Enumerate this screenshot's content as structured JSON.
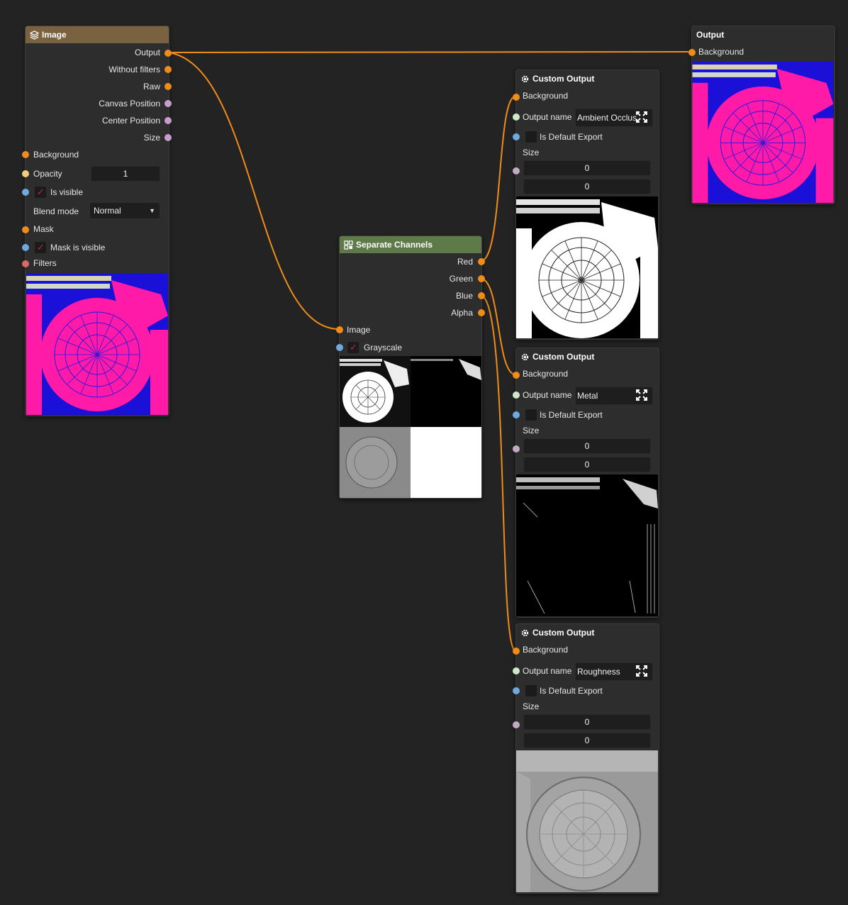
{
  "image_node": {
    "title": "Image",
    "outputs": [
      "Output",
      "Without filters",
      "Raw",
      "Canvas Position",
      "Center Position",
      "Size"
    ],
    "background_label": "Background",
    "opacity_label": "Opacity",
    "opacity_value": "1",
    "is_visible_label": "Is visible",
    "blend_mode_label": "Blend mode",
    "blend_mode_value": "Normal",
    "mask_label": "Mask",
    "mask_visible_label": "Mask is visible",
    "filters_label": "Filters"
  },
  "separate_node": {
    "title": "Separate Channels",
    "outputs": [
      "Red",
      "Green",
      "Blue",
      "Alpha"
    ],
    "image_label": "Image",
    "grayscale_label": "Grayscale"
  },
  "output_node": {
    "title": "Output",
    "background_label": "Background"
  },
  "custom_outputs": [
    {
      "title": "Custom Output",
      "background_label": "Background",
      "output_name_label": "Output name",
      "output_name_value": "Ambient Occlus",
      "default_export_label": "Is Default Export",
      "size_label": "Size",
      "size_w": "0",
      "size_h": "0"
    },
    {
      "title": "Custom Output",
      "background_label": "Background",
      "output_name_label": "Output name",
      "output_name_value": "Metal",
      "default_export_label": "Is Default Export",
      "size_label": "Size",
      "size_w": "0",
      "size_h": "0"
    },
    {
      "title": "Custom Output",
      "background_label": "Background",
      "output_name_label": "Output name",
      "output_name_value": "Roughness",
      "default_export_label": "Is Default Export",
      "size_label": "Size",
      "size_w": "0",
      "size_h": "0"
    }
  ],
  "colors": {
    "wire": "#f08c1a",
    "image_header": "#7a6140",
    "separate_header": "#5e7a48",
    "texture_magenta": "#ff1aa8",
    "texture_blue": "#1a10d8"
  },
  "icons": {
    "image": "layers-icon",
    "separate": "channels-icon",
    "custom_output": "gear-icon",
    "expand": "expand-icon",
    "checkmark": "checkmark-icon"
  }
}
